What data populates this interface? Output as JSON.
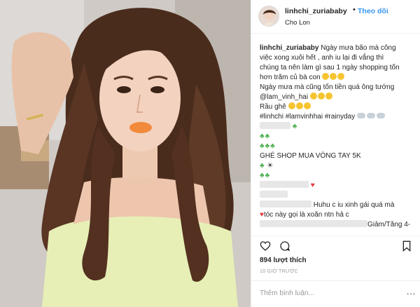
{
  "post": {
    "username": "linhchi_zuriababy",
    "follow_label": "Theo dõi",
    "separator": "•",
    "location": "Cho Lon"
  },
  "caption": {
    "line1_user": "linhchi_zuriababy",
    "line1_text": " Ngày mưa bão mà công",
    "line2": "việc xong xuôi hết , anh iu lại đi vắng thì",
    "line3": "chúng ta nên làm gì sau 1 ngày shopping tốn",
    "line4": "hơn trăm củ bà con",
    "line5": "Ngày mưa mà cũng tốn tiền quá ông tướng",
    "line6": "@lam_vinh_hai",
    "line7": "Rầu ghê",
    "line8": "#linhchi #lamvinhhai #rainyday",
    "line_shop": "GHÉ SHOP MUA VÒNG TAY 5K",
    "comment1": "Huhu c iu xinh gái quá mà",
    "comment2": "tóc này gọi là xoăn ntn hả c",
    "comment3": "Giảm/Tăng 4-"
  },
  "actions": {
    "like_icon": "heart-icon",
    "comment_icon": "comment-icon",
    "save_icon": "bookmark-icon"
  },
  "stats": {
    "likes": "894 lượt thích",
    "time_ago": "10 GIỜ TRƯỚC"
  },
  "comment_box": {
    "placeholder": "Thêm bình luận...",
    "more": "..."
  }
}
